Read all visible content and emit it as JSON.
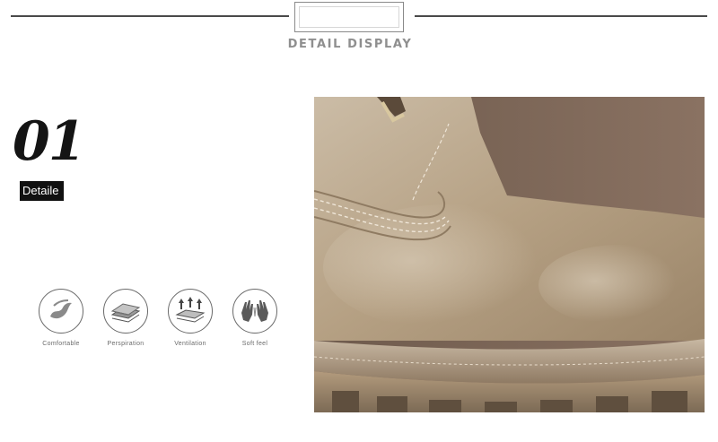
{
  "header": {
    "title": "DETAIL DISPLAY"
  },
  "section": {
    "number": "01",
    "badge": "Detaile"
  },
  "features": [
    {
      "label": "Comfortable",
      "icon": "comfort-flame-icon"
    },
    {
      "label": "Perspiration",
      "icon": "perspiration-layers-icon"
    },
    {
      "label": "Ventilation",
      "icon": "ventilation-arrows-icon"
    },
    {
      "label": "Soft feel",
      "icon": "soft-hands-icon"
    }
  ],
  "photo": {
    "subject": "boot-leather-closeup"
  },
  "colors": {
    "rule": "#4a4a4a",
    "heading": "#8f8f8f",
    "badge_bg": "#111111",
    "suede": "#b7a38a"
  }
}
